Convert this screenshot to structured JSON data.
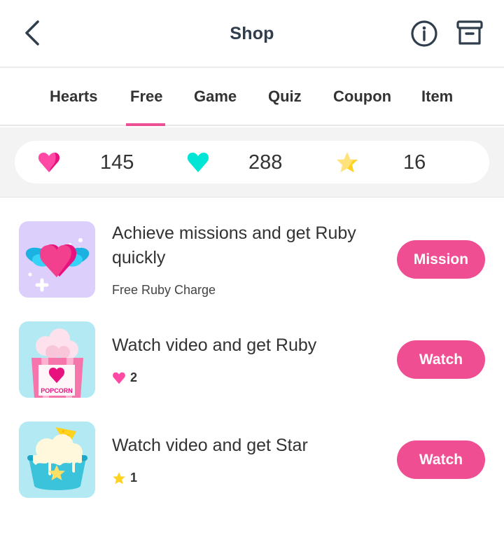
{
  "header": {
    "title": "Shop",
    "back_icon": "chevron-left-icon",
    "info_icon": "info-icon",
    "archive_icon": "archive-box-icon"
  },
  "tabs": [
    {
      "label": "Hearts",
      "active": false
    },
    {
      "label": "Free",
      "active": true
    },
    {
      "label": "Game",
      "active": false
    },
    {
      "label": "Quiz",
      "active": false
    },
    {
      "label": "Coupon",
      "active": false
    },
    {
      "label": "Item",
      "active": false
    }
  ],
  "balances": {
    "ruby": {
      "icon": "pink-heart-icon",
      "value": "145"
    },
    "mint": {
      "icon": "teal-heart-icon",
      "value": "288"
    },
    "star": {
      "icon": "star-icon",
      "value": "16"
    }
  },
  "items": [
    {
      "title": "Achieve missions and get Ruby quickly",
      "subtitle": "Free Ruby Charge",
      "thumb_icon": "winged-heart-icon",
      "button_label": "Mission"
    },
    {
      "title": "Watch video and get Ruby",
      "reward_icon": "pink-heart-icon",
      "reward_value": "2",
      "thumb_icon": "popcorn-icon",
      "thumb_label": "POPCORN",
      "button_label": "Watch"
    },
    {
      "title": "Watch video and get Star",
      "reward_icon": "star-icon",
      "reward_value": "1",
      "thumb_icon": "ice-cream-bowl-icon",
      "button_label": "Watch"
    }
  ],
  "colors": {
    "accent": "#ef4f92",
    "ruby": "#ff3f9d",
    "mint": "#00e5d6",
    "star": "#ffd21f",
    "text_dark": "#2f3d4c"
  }
}
